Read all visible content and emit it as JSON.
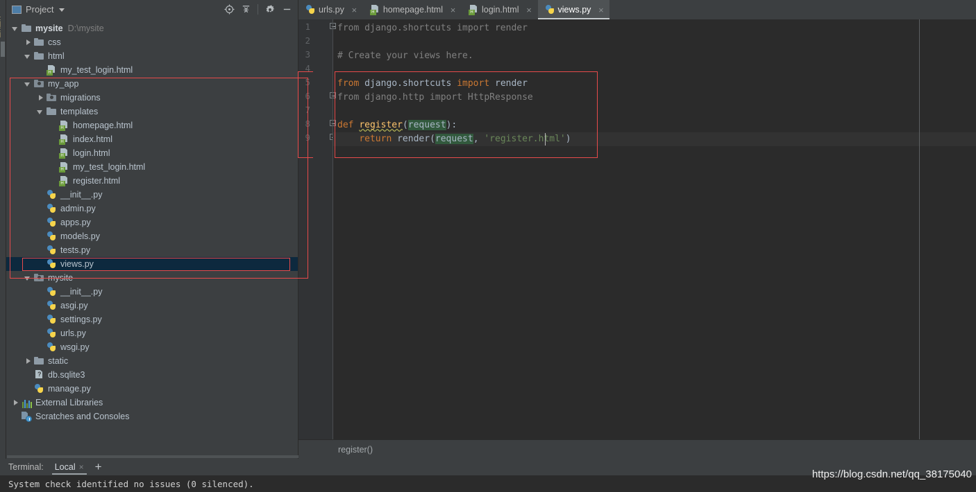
{
  "window": {
    "theme_bg": "#3c3f41",
    "editor_bg": "#2b2b2b",
    "accent_red": "#e84b4b",
    "selection_blue": "#0d293e"
  },
  "project_panel": {
    "title": "Project",
    "title_icon": "project-window-icon",
    "caret_icon": "chevron-down-icon",
    "tools": [
      {
        "name": "locate-icon",
        "glyph": "target"
      },
      {
        "name": "collapse-all-icon",
        "glyph": "collapse"
      },
      {
        "name": "gear-icon",
        "glyph": "gear"
      },
      {
        "name": "minimize-icon",
        "glyph": "dash"
      }
    ],
    "tree": [
      {
        "label": "mysite",
        "sub": "D:\\mysite",
        "icon": "folder-icon",
        "twisty": "open",
        "indent": 0,
        "bold": true,
        "selected": false
      },
      {
        "label": "css",
        "sub": "",
        "icon": "folder-icon",
        "twisty": "closed",
        "indent": 1,
        "bold": false,
        "selected": false
      },
      {
        "label": "html",
        "sub": "",
        "icon": "folder-icon",
        "twisty": "open",
        "indent": 1,
        "bold": false,
        "selected": false
      },
      {
        "label": "my_test_login.html",
        "sub": "",
        "icon": "html-file-icon",
        "twisty": "none",
        "indent": 2,
        "bold": false,
        "selected": false
      },
      {
        "label": "my_app",
        "sub": "",
        "icon": "module-folder-icon",
        "twisty": "open",
        "indent": 1,
        "bold": false,
        "selected": false
      },
      {
        "label": "migrations",
        "sub": "",
        "icon": "module-folder-icon",
        "twisty": "closed",
        "indent": 2,
        "bold": false,
        "selected": false
      },
      {
        "label": "templates",
        "sub": "",
        "icon": "folder-icon",
        "twisty": "open",
        "indent": 2,
        "bold": false,
        "selected": false
      },
      {
        "label": "homepage.html",
        "sub": "",
        "icon": "html-file-icon",
        "twisty": "none",
        "indent": 3,
        "bold": false,
        "selected": false
      },
      {
        "label": "index.html",
        "sub": "",
        "icon": "html-file-icon",
        "twisty": "none",
        "indent": 3,
        "bold": false,
        "selected": false
      },
      {
        "label": "login.html",
        "sub": "",
        "icon": "html-file-icon",
        "twisty": "none",
        "indent": 3,
        "bold": false,
        "selected": false
      },
      {
        "label": "my_test_login.html",
        "sub": "",
        "icon": "html-file-icon",
        "twisty": "none",
        "indent": 3,
        "bold": false,
        "selected": false
      },
      {
        "label": "register.html",
        "sub": "",
        "icon": "html-file-icon",
        "twisty": "none",
        "indent": 3,
        "bold": false,
        "selected": false
      },
      {
        "label": "__init__.py",
        "sub": "",
        "icon": "python-file-icon",
        "twisty": "none",
        "indent": 2,
        "bold": false,
        "selected": false
      },
      {
        "label": "admin.py",
        "sub": "",
        "icon": "python-file-icon",
        "twisty": "none",
        "indent": 2,
        "bold": false,
        "selected": false
      },
      {
        "label": "apps.py",
        "sub": "",
        "icon": "python-file-icon",
        "twisty": "none",
        "indent": 2,
        "bold": false,
        "selected": false
      },
      {
        "label": "models.py",
        "sub": "",
        "icon": "python-file-icon",
        "twisty": "none",
        "indent": 2,
        "bold": false,
        "selected": false
      },
      {
        "label": "tests.py",
        "sub": "",
        "icon": "python-file-icon",
        "twisty": "none",
        "indent": 2,
        "bold": false,
        "selected": false
      },
      {
        "label": "views.py",
        "sub": "",
        "icon": "python-file-icon",
        "twisty": "none",
        "indent": 2,
        "bold": false,
        "selected": true
      },
      {
        "label": "mysite",
        "sub": "",
        "icon": "module-folder-icon",
        "twisty": "open",
        "indent": 1,
        "bold": false,
        "selected": false
      },
      {
        "label": "__init__.py",
        "sub": "",
        "icon": "python-file-icon",
        "twisty": "none",
        "indent": 2,
        "bold": false,
        "selected": false
      },
      {
        "label": "asgi.py",
        "sub": "",
        "icon": "python-file-icon",
        "twisty": "none",
        "indent": 2,
        "bold": false,
        "selected": false
      },
      {
        "label": "settings.py",
        "sub": "",
        "icon": "python-file-icon",
        "twisty": "none",
        "indent": 2,
        "bold": false,
        "selected": false
      },
      {
        "label": "urls.py",
        "sub": "",
        "icon": "python-file-icon",
        "twisty": "none",
        "indent": 2,
        "bold": false,
        "selected": false
      },
      {
        "label": "wsgi.py",
        "sub": "",
        "icon": "python-file-icon",
        "twisty": "none",
        "indent": 2,
        "bold": false,
        "selected": false
      },
      {
        "label": "static",
        "sub": "",
        "icon": "folder-icon",
        "twisty": "closed",
        "indent": 1,
        "bold": false,
        "selected": false
      },
      {
        "label": "db.sqlite3",
        "sub": "",
        "icon": "unknown-file-icon",
        "twisty": "none",
        "indent": 1,
        "bold": false,
        "selected": false
      },
      {
        "label": "manage.py",
        "sub": "",
        "icon": "python-file-icon",
        "twisty": "none",
        "indent": 1,
        "bold": false,
        "selected": false
      },
      {
        "label": "External Libraries",
        "sub": "",
        "icon": "external-libraries-icon",
        "twisty": "closed",
        "indent": 0,
        "bold": false,
        "selected": false
      },
      {
        "label": "Scratches and Consoles",
        "sub": "",
        "icon": "scratches-icon",
        "twisty": "none",
        "indent": 0,
        "bold": false,
        "selected": false
      }
    ]
  },
  "editor": {
    "tabs": [
      {
        "label": "urls.py",
        "icon": "python-file-icon",
        "active": false,
        "close_glyph": "×"
      },
      {
        "label": "homepage.html",
        "icon": "html-file-icon",
        "active": false,
        "close_glyph": "×"
      },
      {
        "label": "login.html",
        "icon": "html-file-icon",
        "active": false,
        "close_glyph": "×"
      },
      {
        "label": "views.py",
        "icon": "python-file-icon",
        "active": true,
        "close_glyph": "×"
      }
    ],
    "line_numbers": [
      "1",
      "2",
      "3",
      "4",
      "5",
      "6",
      "7",
      "8",
      "9"
    ],
    "current_line": 9,
    "code_lines": [
      {
        "no": 1,
        "tokens": [
          {
            "t": "from django.shortcuts import render",
            "c": "dim"
          }
        ]
      },
      {
        "no": 2,
        "tokens": []
      },
      {
        "no": 3,
        "tokens": [
          {
            "t": "# Create your views here.",
            "c": "dim"
          }
        ]
      },
      {
        "no": 4,
        "tokens": []
      },
      {
        "no": 5,
        "tokens": [
          {
            "t": "from",
            "c": "kw"
          },
          {
            "t": " django.shortcuts ",
            "c": ""
          },
          {
            "t": "import",
            "c": "kw"
          },
          {
            "t": " render",
            "c": ""
          }
        ]
      },
      {
        "no": 6,
        "tokens": [
          {
            "t": "from django.http import HttpResponse",
            "c": "dim"
          }
        ]
      },
      {
        "no": 7,
        "tokens": []
      },
      {
        "no": 8,
        "tokens": [
          {
            "t": "def",
            "c": "kw"
          },
          {
            "t": " ",
            "c": ""
          },
          {
            "t": "register",
            "c": "fn squiggle"
          },
          {
            "t": "(",
            "c": ""
          },
          {
            "t": "request",
            "c": "hl-green"
          },
          {
            "t": "):",
            "c": ""
          }
        ]
      },
      {
        "no": 9,
        "tokens": [
          {
            "t": "    ",
            "c": ""
          },
          {
            "t": "return",
            "c": "kw"
          },
          {
            "t": " render(",
            "c": ""
          },
          {
            "t": "request",
            "c": "hl-green"
          },
          {
            "t": ", ",
            "c": ""
          },
          {
            "t": "'register.html'",
            "c": "str"
          },
          {
            "t": ")",
            "c": ""
          }
        ]
      }
    ],
    "breadcrumb": "register()"
  },
  "terminal": {
    "label": "Terminal:",
    "tabs": [
      {
        "label": "Local",
        "active": true,
        "close_glyph": "×"
      }
    ],
    "add_glyph": "+",
    "output": "System check identified no issues (0 silenced)."
  },
  "watermark": "https://blog.csdn.net/qq_38175040"
}
